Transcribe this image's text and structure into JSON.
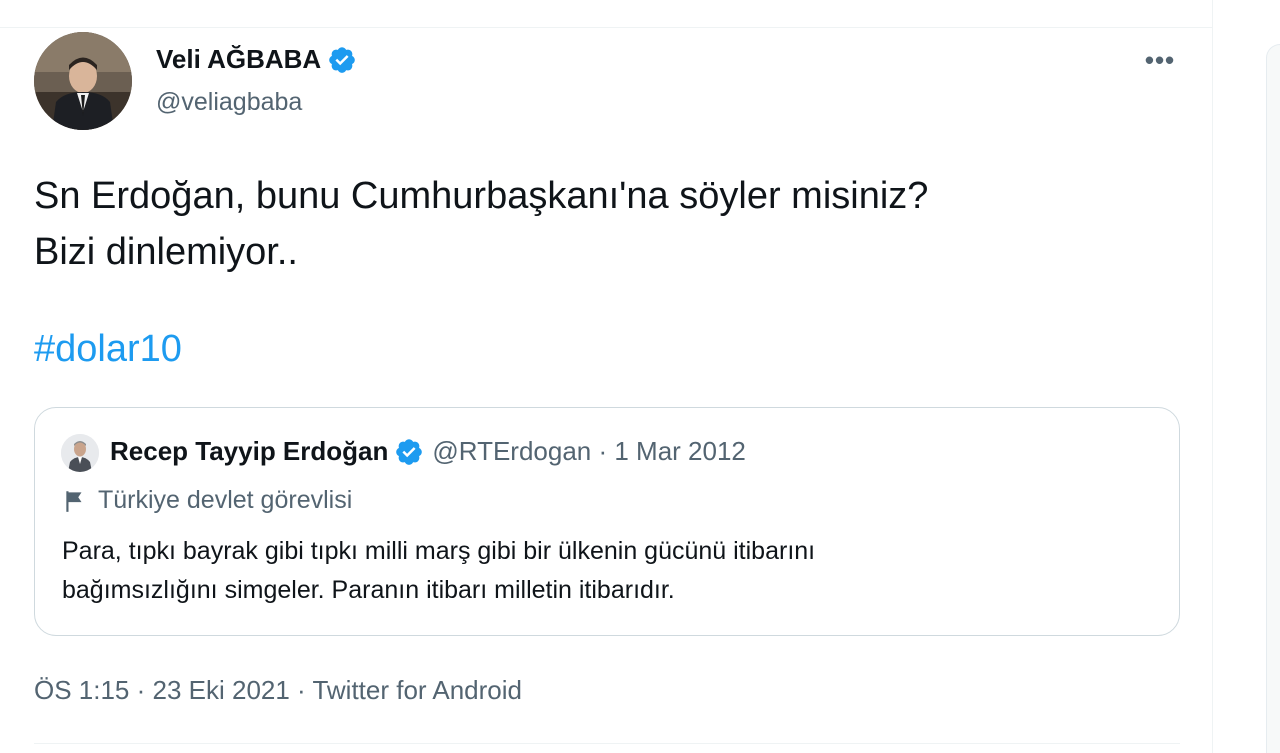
{
  "colors": {
    "accent": "#1d9bf0",
    "text_primary": "#0f1419",
    "text_secondary": "#536471",
    "border": "#cfd9de"
  },
  "tweet": {
    "author": {
      "name": "Veli AĞBABA",
      "handle": "@veliagbaba",
      "verified_icon": "verified-badge-icon",
      "avatar_icon": "avatar-photo"
    },
    "more_label": "•••",
    "text_lines": [
      "Sn Erdoğan, bunu Cumhurbaşkanı'na söyler misiniz?",
      "Bizi dinlemiyor.."
    ],
    "hashtag": "#dolar10",
    "quoted": {
      "name": "Recep Tayyip Erdoğan",
      "meta": "@RTErdogan · 1 Mar 2012",
      "label": "Türkiye devlet görevlisi",
      "label_icon": "flag-icon",
      "text_lines": [
        "Para, tıpkı bayrak gibi tıpkı milli marş gibi bir ülkenin gücünü itibarını",
        "bağımsızlığını simgeler. Paranın itibarı milletin itibarıdır."
      ]
    },
    "meta": "ÖS 1:15 · 23 Eki 2021 · Twitter for Android"
  }
}
